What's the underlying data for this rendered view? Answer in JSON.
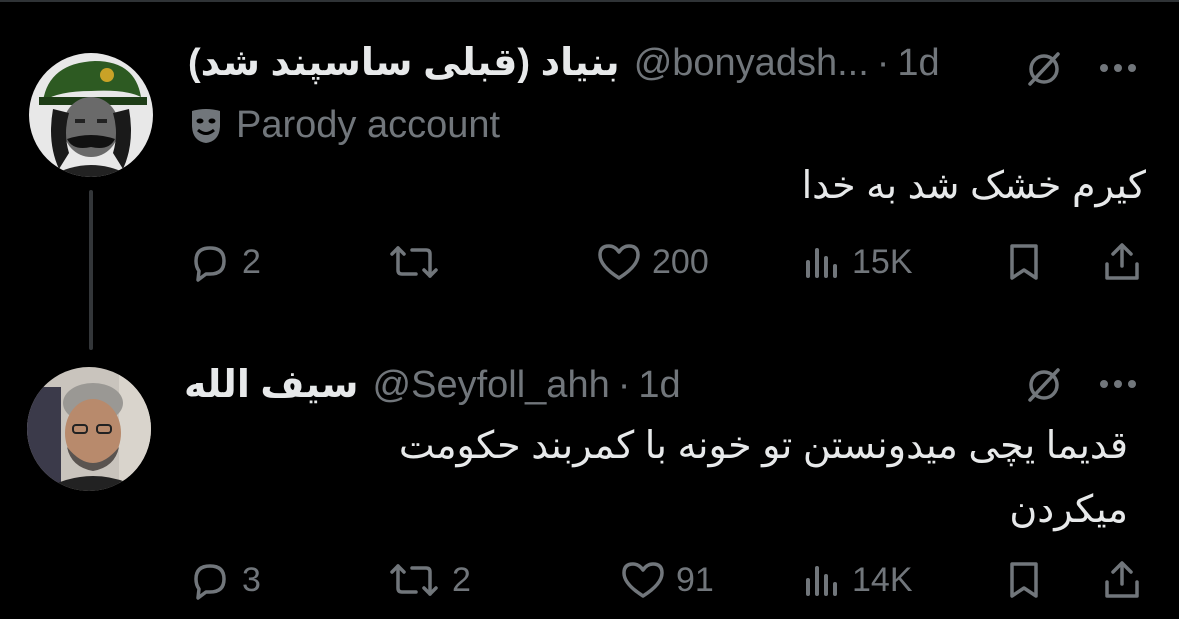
{
  "colors": {
    "background": "#000000",
    "text": "#e7e9ea",
    "muted": "#71767b",
    "line": "#333639"
  },
  "tweets": [
    {
      "name": "بنیاد (قبلی ساسپند شد)",
      "handle": "@bonyadsh...",
      "separator": "·",
      "time": "1d",
      "badge": {
        "icon": "drama-masks-icon",
        "label": "Parody account"
      },
      "text": "کیرم خشک شد به خدا",
      "actions": {
        "replies": "2",
        "reposts": "",
        "likes": "200",
        "views": "15K"
      }
    },
    {
      "name": "سیف الله",
      "handle": "@Seyfoll_ahh",
      "separator": "·",
      "time": "1d",
      "text_line1": "قدیما یچی میدونستن تو خونه با کمربند حکومت",
      "text_line2": "میکردن",
      "actions": {
        "replies": "3",
        "reposts": "2",
        "likes": "91",
        "views": "14K"
      }
    }
  ]
}
